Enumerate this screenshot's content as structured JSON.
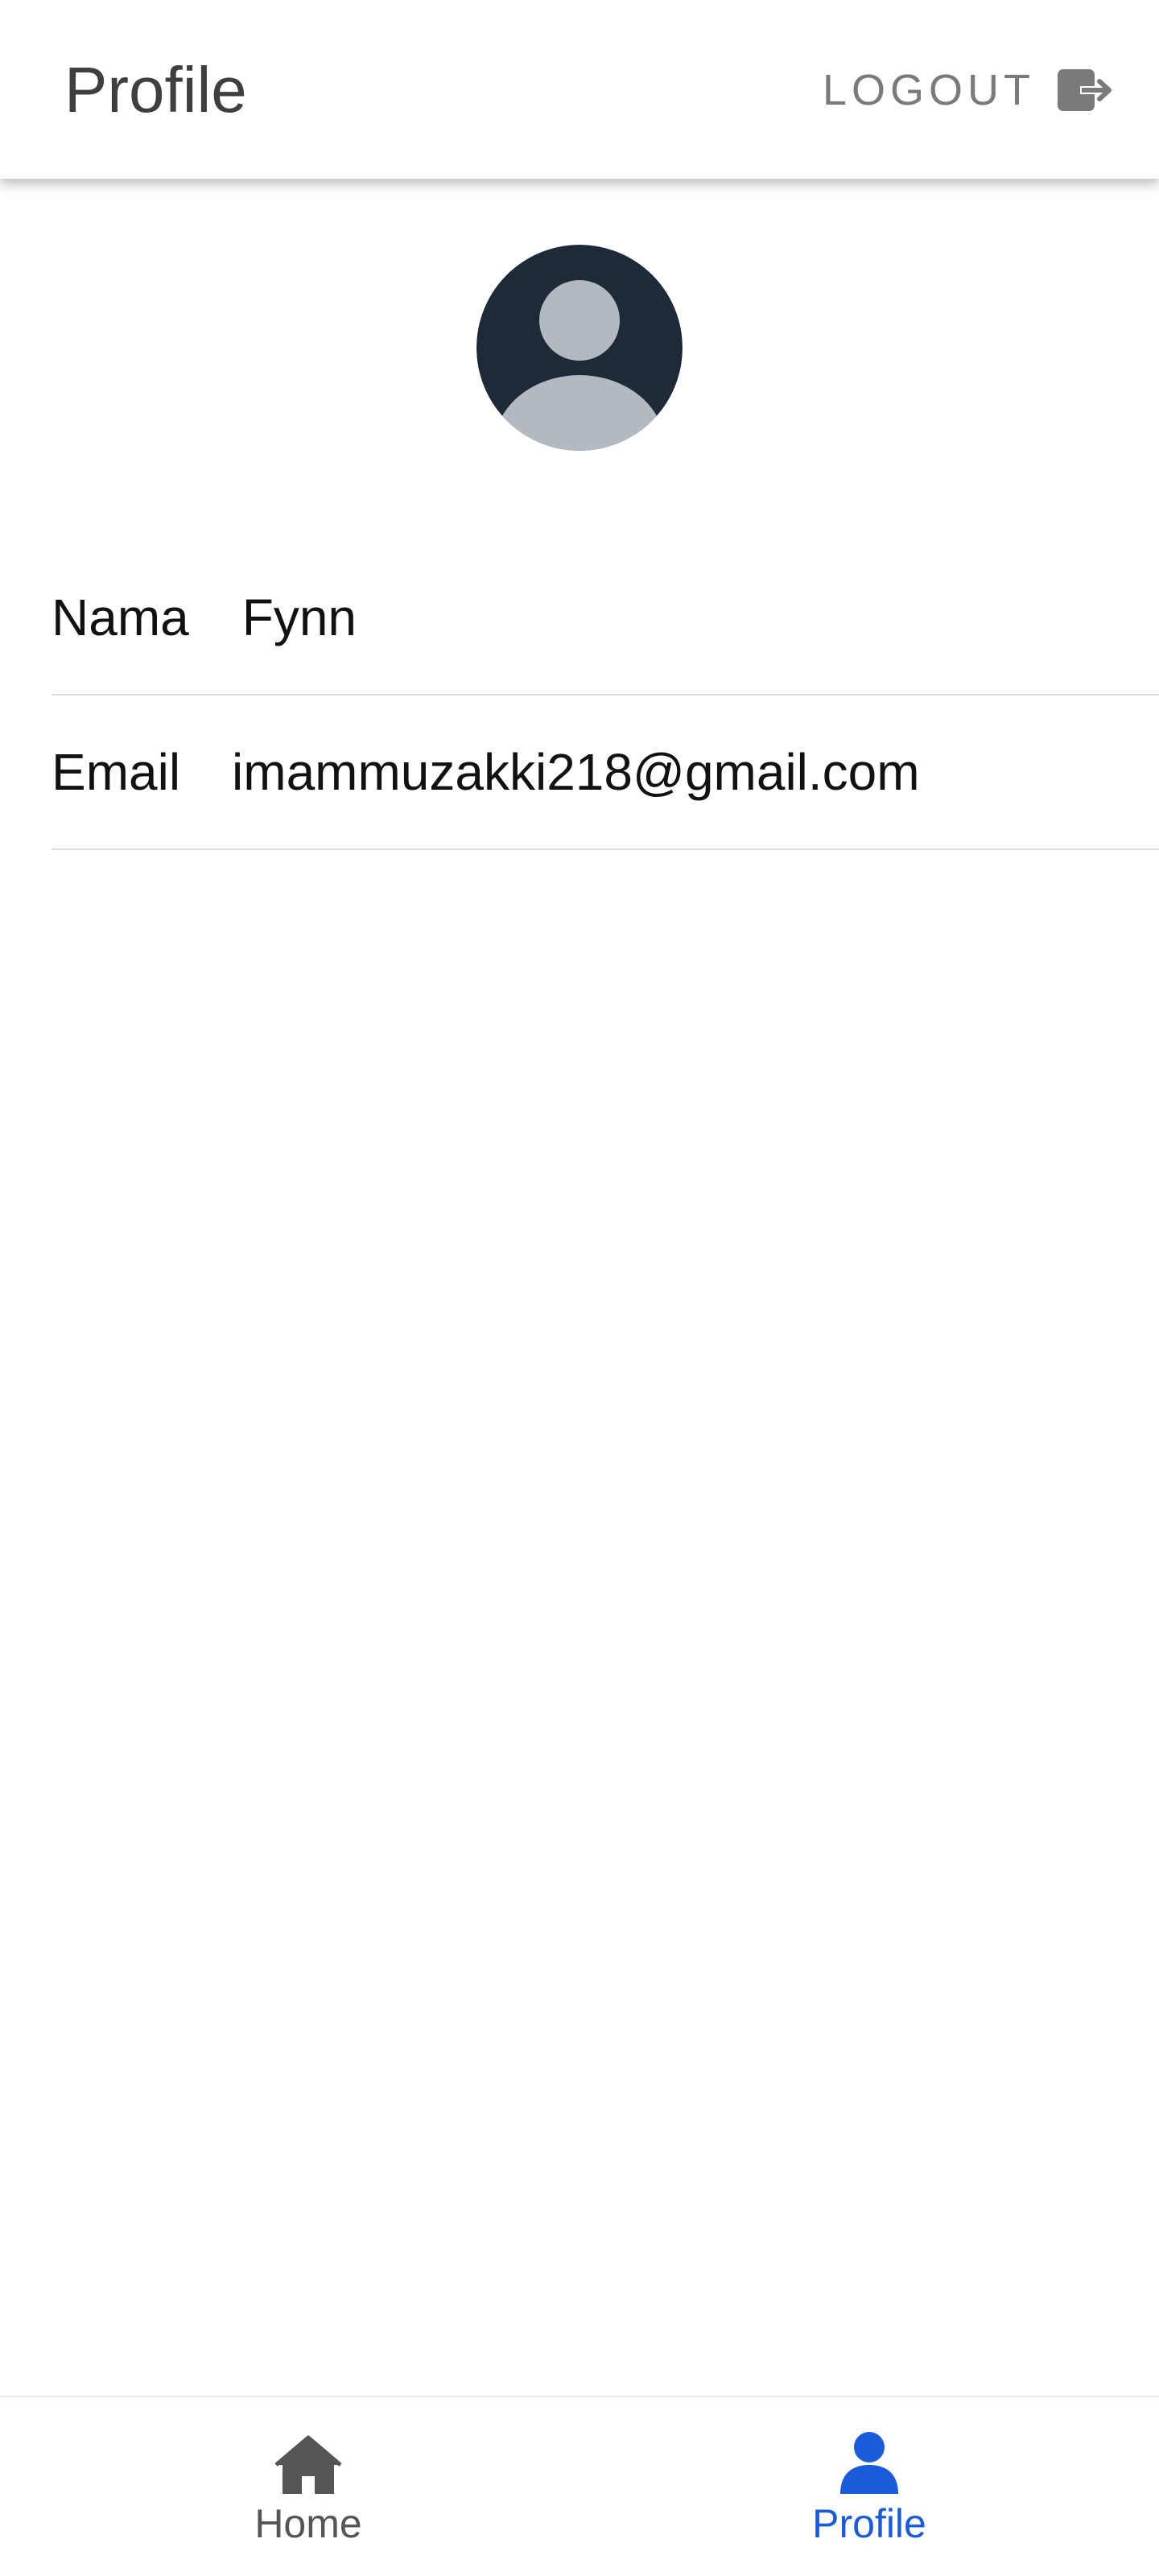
{
  "header": {
    "title": "Profile",
    "logout_label": "LOGOUT",
    "logout_icon": "logout-icon"
  },
  "avatar": {
    "icon": "user-avatar-icon",
    "colors": {
      "background": "#1f2a38",
      "figure": "#b3b9c0"
    }
  },
  "profile": {
    "rows": [
      {
        "label": "Nama",
        "value": "Fynn"
      },
      {
        "label": "Email",
        "value": "imammuzakki218@gmail.com"
      }
    ]
  },
  "bottom_nav": {
    "items": [
      {
        "label": "Home",
        "icon": "home-icon",
        "active": false,
        "color": "#555555"
      },
      {
        "label": "Profile",
        "icon": "person-icon",
        "active": true,
        "color": "#1a5bdc"
      }
    ]
  }
}
